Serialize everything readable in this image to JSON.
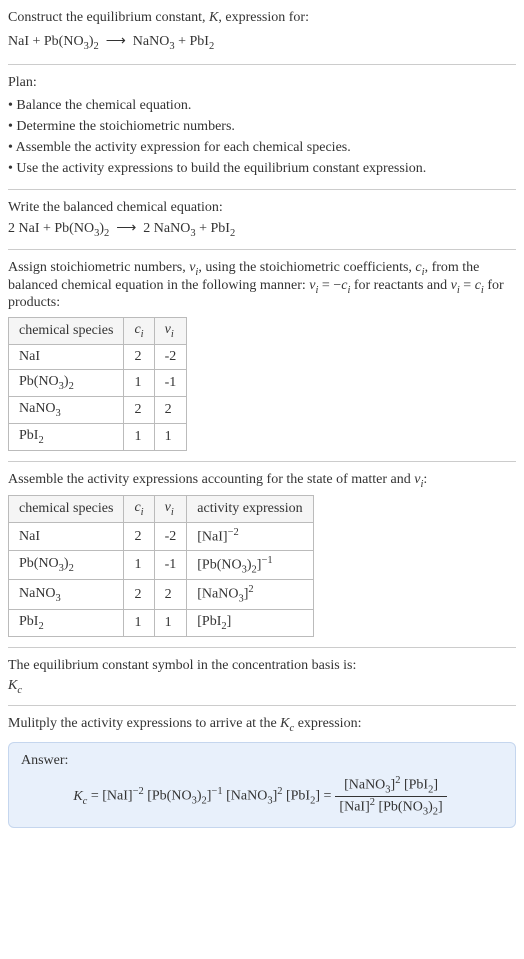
{
  "intro": {
    "line1": "Construct the equilibrium constant, K, expression for:",
    "reaction_unbalanced": "NaI + Pb(NO₃)₂  ⟶  NaNO₃ + PbI₂"
  },
  "plan": {
    "heading": "Plan:",
    "items": [
      "• Balance the chemical equation.",
      "• Determine the stoichiometric numbers.",
      "• Assemble the activity expression for each chemical species.",
      "• Use the activity expressions to build the equilibrium constant expression."
    ]
  },
  "balanced": {
    "heading": "Write the balanced chemical equation:",
    "reaction": "2 NaI + Pb(NO₃)₂  ⟶  2 NaNO₃ + PbI₂"
  },
  "stoich": {
    "intro_before_nu": "Assign stoichiometric numbers, ",
    "intro_after_nu": ", using the stoichiometric coefficients, ",
    "intro_after_ci": ", from the balanced chemical equation in the following manner: ",
    "rule_reactants": " for reactants and ",
    "rule_products": " for products:",
    "headers": {
      "species": "chemical species",
      "ci": "cᵢ",
      "nu": "νᵢ"
    },
    "rows": [
      {
        "species": "NaI",
        "ci": "2",
        "nu": "-2"
      },
      {
        "species": "Pb(NO₃)₂",
        "ci": "1",
        "nu": "-1"
      },
      {
        "species": "NaNO₃",
        "ci": "2",
        "nu": "2"
      },
      {
        "species": "PbI₂",
        "ci": "1",
        "nu": "1"
      }
    ]
  },
  "activity": {
    "intro": "Assemble the activity expressions accounting for the state of matter and νᵢ:",
    "headers": {
      "species": "chemical species",
      "ci": "cᵢ",
      "nu": "νᵢ",
      "expr": "activity expression"
    },
    "rows": [
      {
        "species": "NaI",
        "ci": "2",
        "nu": "-2",
        "expr": "[NaI]⁻²"
      },
      {
        "species": "Pb(NO₃)₂",
        "ci": "1",
        "nu": "-1",
        "expr": "[Pb(NO₃)₂]⁻¹"
      },
      {
        "species": "NaNO₃",
        "ci": "2",
        "nu": "2",
        "expr": "[NaNO₃]²"
      },
      {
        "species": "PbI₂",
        "ci": "1",
        "nu": "1",
        "expr": "[PbI₂]"
      }
    ]
  },
  "kc_symbol": {
    "line": "The equilibrium constant symbol in the concentration basis is:",
    "symbol": "K_c"
  },
  "multiply": {
    "line": "Mulitply the activity expressions to arrive at the K_c expression:"
  },
  "answer": {
    "label": "Answer:",
    "lhs": "K_c = [NaI]⁻² [Pb(NO₃)₂]⁻¹ [NaNO₃]² [PbI₂] = ",
    "frac_num": "[NaNO₃]² [PbI₂]",
    "frac_den": "[NaI]² [Pb(NO₃)₂]"
  }
}
